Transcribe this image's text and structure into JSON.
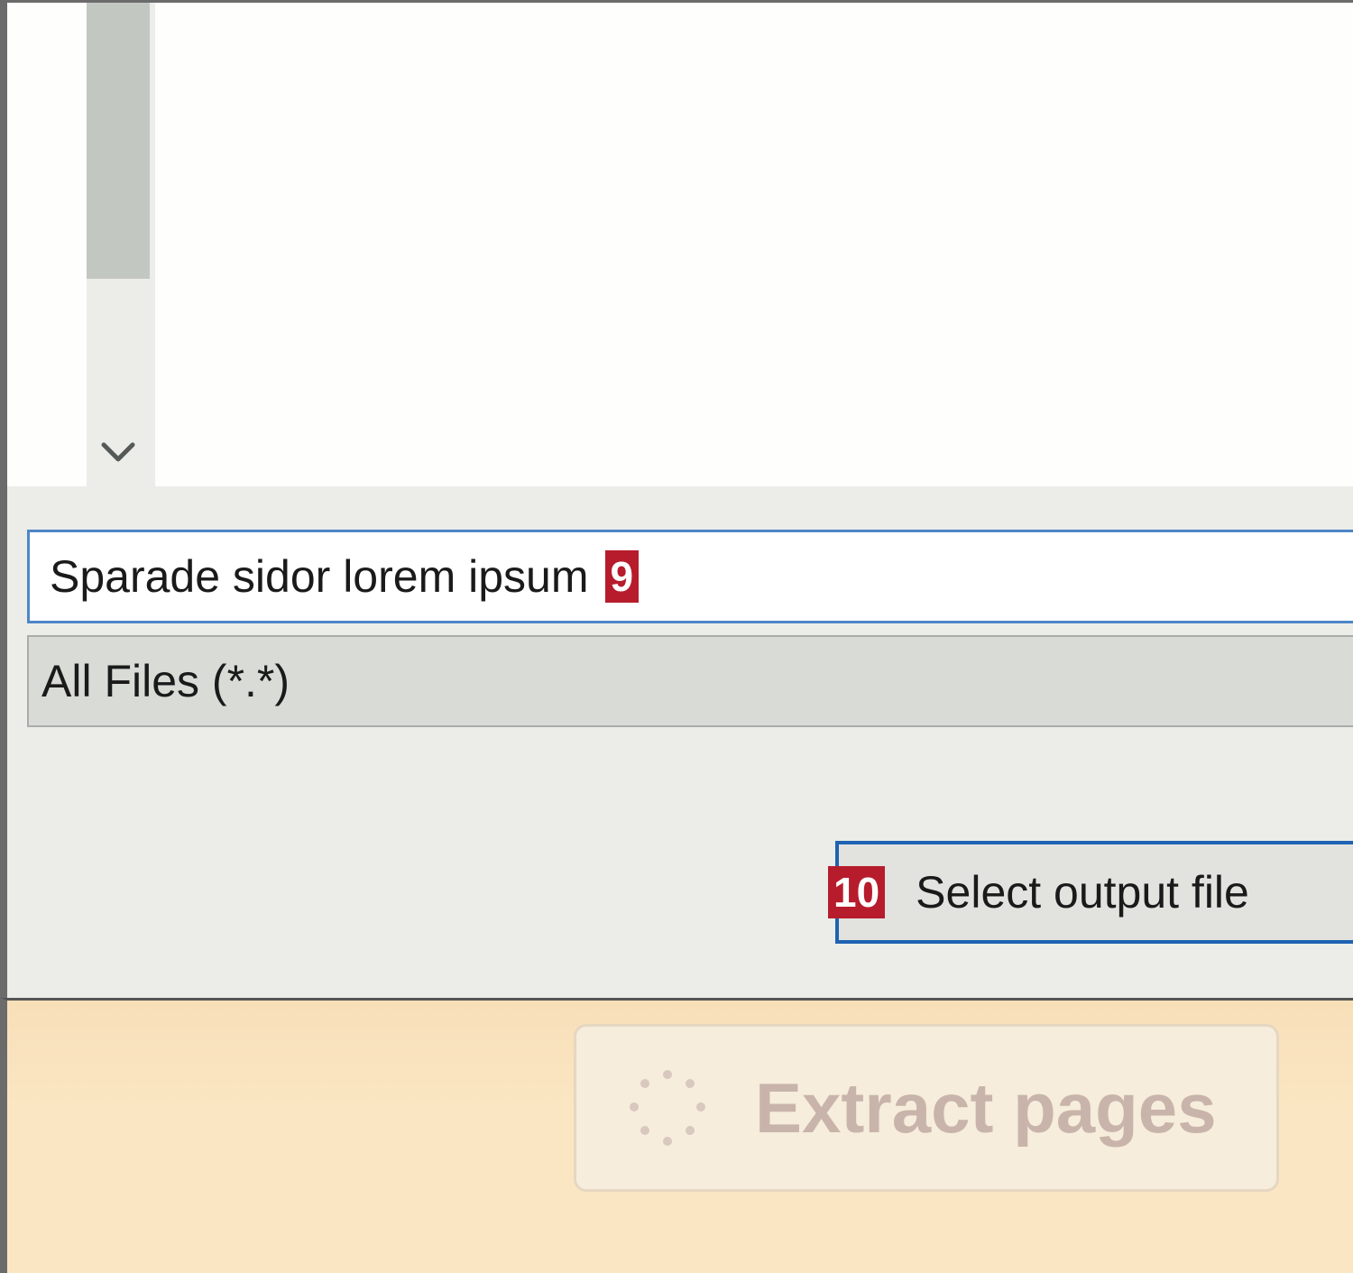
{
  "file_dialog": {
    "filename_value": "Sparade sidor lorem ipsum",
    "filename_badge": "9",
    "filetype_value": "All Files (*.*)",
    "select_output_label": "Select output file",
    "select_output_badge": "10",
    "scroll_down_icon": "chevron-down-icon"
  },
  "action_bar": {
    "extract_label": "Extract pages",
    "extract_icon": "spinner-icon",
    "extract_disabled": true
  },
  "colors": {
    "badge": "#b71c2c",
    "input_focus_border": "#4e86c7",
    "button_focus_border": "#1e63b3",
    "action_bar_bg": "#fbe6c3",
    "extract_text_disabled": "#c9b4ab"
  }
}
